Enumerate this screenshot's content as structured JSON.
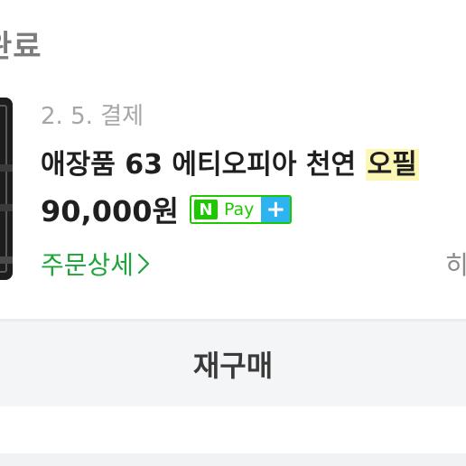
{
  "order": {
    "status_title": "완료",
    "date_label": "2. 5. 결제",
    "product_name": "애장품 63 에티오피아 천연 ",
    "product_name_highlight": "오필",
    "price": "90,000원",
    "payment_badge": {
      "n_label": "N",
      "pay_label": "Pay",
      "plus_label": "+"
    },
    "detail_link": "주문상세",
    "right_clip_text": "히"
  },
  "actions": {
    "reorder_label": "재구매"
  },
  "colors": {
    "accent_green": "#1fa33a",
    "npay_green": "#1ec800",
    "npay_plus_blue": "#2db4f0",
    "highlight_yellow": "#fdf7b6"
  }
}
